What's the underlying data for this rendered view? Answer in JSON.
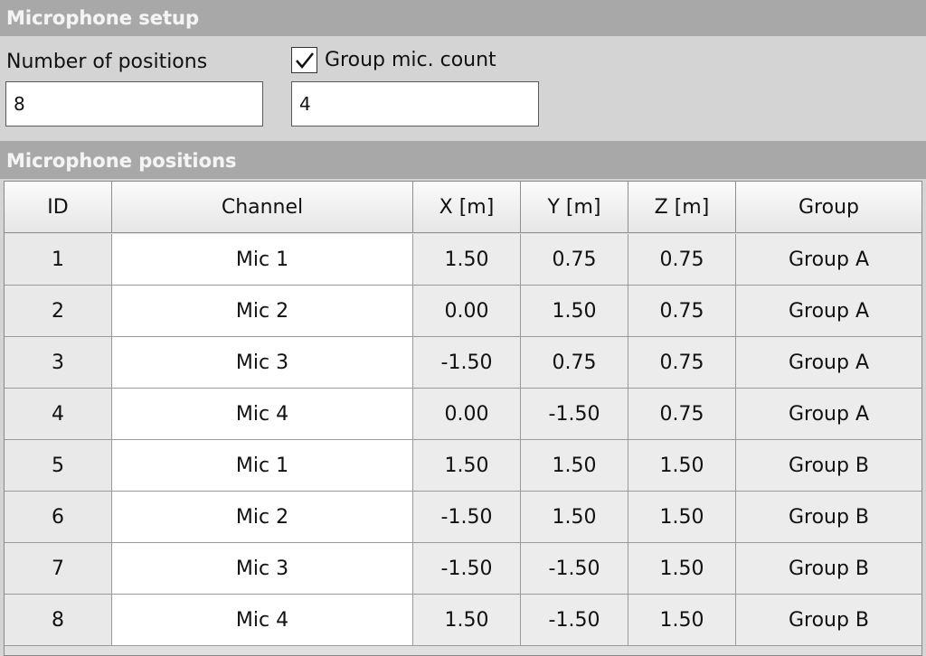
{
  "setup": {
    "header": "Microphone setup",
    "positions_label": "Number of positions",
    "positions_value": "8",
    "group_label": "Group mic. count",
    "group_checked": true,
    "group_value": "4"
  },
  "positions": {
    "header": "Microphone positions",
    "columns": [
      "ID",
      "Channel",
      "X [m]",
      "Y [m]",
      "Z [m]",
      "Group"
    ],
    "rows": [
      [
        "1",
        "Mic 1",
        "1.50",
        "0.75",
        "0.75",
        "Group A"
      ],
      [
        "2",
        "Mic 2",
        "0.00",
        "1.50",
        "0.75",
        "Group A"
      ],
      [
        "3",
        "Mic 3",
        "-1.50",
        "0.75",
        "0.75",
        "Group A"
      ],
      [
        "4",
        "Mic 4",
        "0.00",
        "-1.50",
        "0.75",
        "Group A"
      ],
      [
        "5",
        "Mic 1",
        "1.50",
        "1.50",
        "1.50",
        "Group B"
      ],
      [
        "6",
        "Mic 2",
        "-1.50",
        "1.50",
        "1.50",
        "Group B"
      ],
      [
        "7",
        "Mic 3",
        "-1.50",
        "-1.50",
        "1.50",
        "Group B"
      ],
      [
        "8",
        "Mic 4",
        "1.50",
        "-1.50",
        "1.50",
        "Group B"
      ]
    ]
  },
  "icons": {
    "checkbox": "checkmark-icon"
  }
}
